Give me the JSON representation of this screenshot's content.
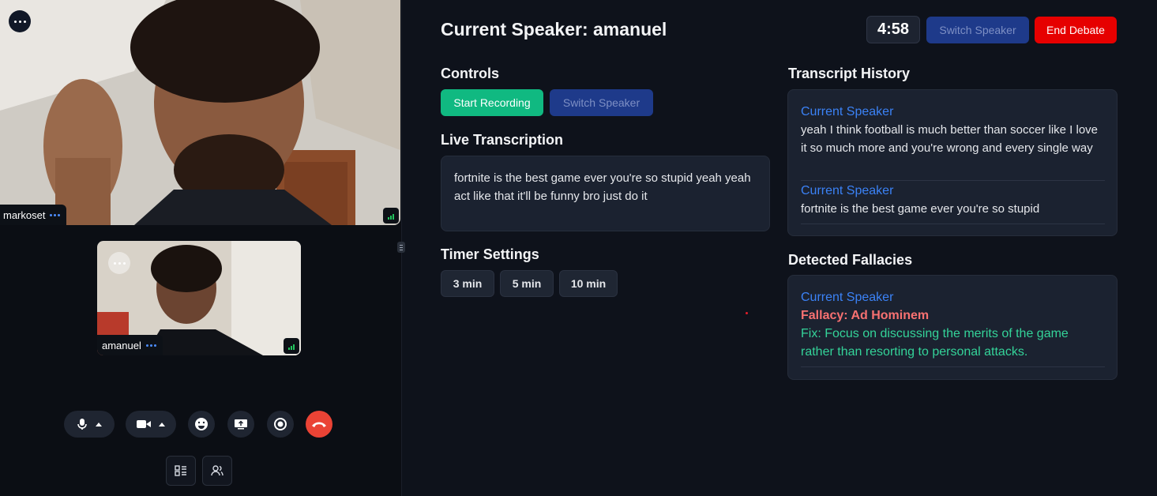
{
  "participants": [
    {
      "name": "markoset"
    },
    {
      "name": "amanuel"
    }
  ],
  "app": {
    "title": "Current Speaker: amanuel",
    "timer": "4:58",
    "switch_speaker_label": "Switch Speaker",
    "end_debate_label": "End Debate",
    "controls": {
      "heading": "Controls",
      "start_recording_label": "Start Recording",
      "switch_speaker_label": "Switch Speaker"
    },
    "live": {
      "heading": "Live Transcription",
      "text": "fortnite is the best game ever you're so stupid yeah yeah act like that it'll be funny bro just do it"
    },
    "timer_settings": {
      "heading": "Timer Settings",
      "options": [
        "3 min",
        "5 min",
        "10 min"
      ]
    },
    "history": {
      "heading": "Transcript History",
      "entries": [
        {
          "speaker": "Current Speaker",
          "text": "yeah I think football is much better than soccer like I love it so much more and you're wrong and every single way"
        },
        {
          "speaker": "Current Speaker",
          "text": "fortnite is the best game ever you're so stupid"
        }
      ]
    },
    "fallacies": {
      "heading": "Detected Fallacies",
      "entries": [
        {
          "speaker": "Current Speaker",
          "fallacy": "Fallacy: Ad Hominem",
          "fix": "Fix: Focus on discussing the merits of the game rather than resorting to personal attacks."
        }
      ]
    }
  },
  "colors": {
    "accent_blue": "#3b82f6",
    "danger": "#e60000",
    "success": "#10b981",
    "fallacy": "#f87171"
  }
}
